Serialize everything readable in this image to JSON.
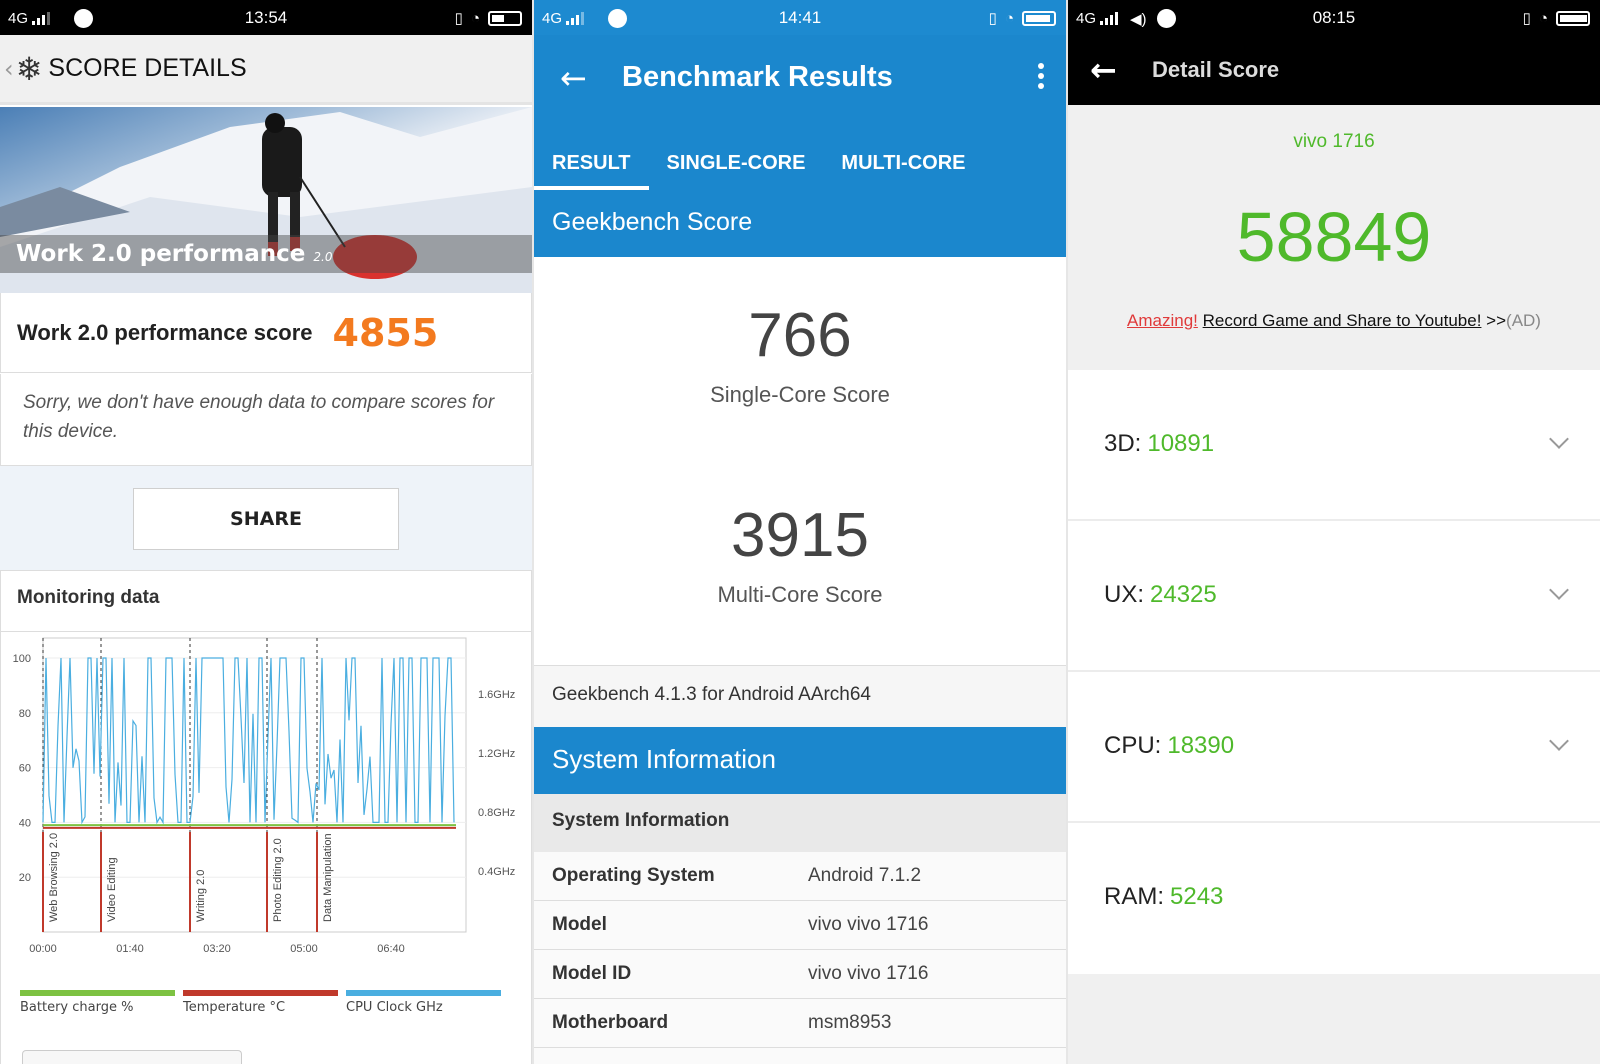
{
  "screen1": {
    "status": {
      "network": "4G",
      "time": "13:54"
    },
    "header": {
      "title": "SCORE DETAILS"
    },
    "hero": {
      "label": "Work 2.0 performance",
      "version": "2.0"
    },
    "score": {
      "label": "Work 2.0 performance score",
      "value": "4855"
    },
    "message": "Sorry, we don't have enough data to compare scores for this device.",
    "share_label": "SHARE",
    "monitoring_title": "Monitoring data",
    "chart_data": {
      "type": "line",
      "y_left_ticks": [
        "100",
        "80",
        "60",
        "40",
        "20"
      ],
      "y_right_ticks": [
        "1.6GHz",
        "1.2GHz",
        "0.8GHz",
        "0.4GHz"
      ],
      "x_ticks": [
        "00:00",
        "01:40",
        "03:20",
        "05:00",
        "06:40"
      ],
      "ylim": [
        0,
        100
      ],
      "sections": [
        "Web Browsing 2.0",
        "Video Editing",
        "Writing 2.0",
        "Photo Editing 2.0",
        "Data Manipulation"
      ],
      "legend": [
        {
          "name": "Battery charge %",
          "color": "#7dc242"
        },
        {
          "name": "Temperature °C",
          "color": "#c0392b"
        },
        {
          "name": "CPU Clock GHz",
          "color": "#4aaee0"
        }
      ]
    }
  },
  "screen2": {
    "status": {
      "network": "4G",
      "time": "14:41"
    },
    "title": "Benchmark Results",
    "tabs": [
      "RESULT",
      "SINGLE-CORE",
      "MULTI-CORE"
    ],
    "section_title": "Geekbench Score",
    "single_core": {
      "value": "766",
      "label": "Single-Core Score"
    },
    "multi_core": {
      "value": "3915",
      "label": "Multi-Core Score"
    },
    "version": "Geekbench 4.1.3 for Android AArch64",
    "sysinfo_title": "System Information",
    "sysinfo_sub": "System Information",
    "rows": [
      {
        "k": "Operating System",
        "v": "Android 7.1.2"
      },
      {
        "k": "Model",
        "v": "vivo vivo 1716"
      },
      {
        "k": "Model ID",
        "v": "vivo vivo 1716"
      },
      {
        "k": "Motherboard",
        "v": "msm8953"
      }
    ]
  },
  "screen3": {
    "status": {
      "network": "4G",
      "time": "08:15"
    },
    "title": "Detail Score",
    "device": "vivo 1716",
    "total": "58849",
    "ad": {
      "amazing": "Amazing!",
      "record": "Record Game and Share to Youtube!",
      "arrows": ">>",
      "tag": "(AD)"
    },
    "scores": [
      {
        "k": "3D:",
        "v": "10891"
      },
      {
        "k": "UX:",
        "v": "24325"
      },
      {
        "k": "CPU:",
        "v": "18390"
      },
      {
        "k": "RAM:",
        "v": "5243"
      }
    ]
  },
  "colors": {
    "accent_orange": "#f37a1f",
    "geekbench_blue": "#1b87cd",
    "antutu_green": "#4fb92b"
  }
}
